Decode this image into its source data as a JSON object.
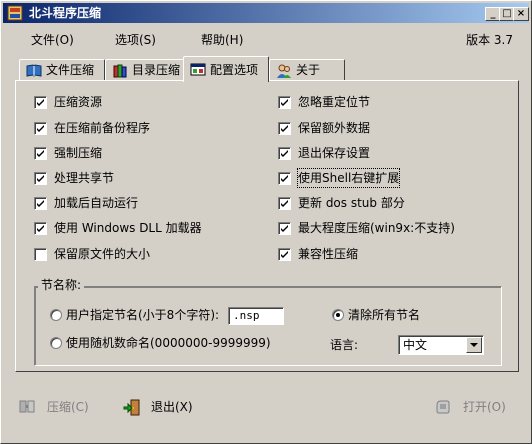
{
  "window": {
    "title": "北斗程序压缩",
    "minimize_label": "_",
    "maximize_label": "□",
    "close_label": "×"
  },
  "menu": [
    {
      "label": "文件(O)"
    },
    {
      "label": "选项(S)"
    },
    {
      "label": "帮助(H)"
    }
  ],
  "version": "版本 3.7",
  "tabs": [
    {
      "label": "文件压缩",
      "icon": "book-icon",
      "active": false
    },
    {
      "label": "目录压缩",
      "icon": "books-icon",
      "active": false
    },
    {
      "label": "配置选项",
      "icon": "config-icon",
      "active": true
    },
    {
      "label": "关于",
      "icon": "users-icon",
      "active": false
    }
  ],
  "options_left": [
    {
      "label": "压缩资源",
      "checked": true
    },
    {
      "label": "在压缩前备份程序",
      "checked": true
    },
    {
      "label": "强制压缩",
      "checked": true
    },
    {
      "label": "处理共享节",
      "checked": true
    },
    {
      "label": "加载后自动运行",
      "checked": true
    },
    {
      "label": "使用 Windows DLL 加载器",
      "checked": true
    },
    {
      "label": "保留原文件的大小",
      "checked": false
    }
  ],
  "options_right": [
    {
      "label": "忽略重定位节",
      "checked": true
    },
    {
      "label": "保留额外数据",
      "checked": true
    },
    {
      "label": "退出保存设置",
      "checked": true
    },
    {
      "label": "使用Shell右键扩展",
      "checked": true,
      "focused": true
    },
    {
      "label": "更新 dos stub 部分",
      "checked": true
    },
    {
      "label": "最大程度压缩(win9x:不支持)",
      "checked": true
    },
    {
      "label": "兼容性压缩",
      "checked": true
    }
  ],
  "section_names": {
    "title": "节名称:",
    "custom_label": "用户指定节名(小于8个字符):",
    "custom_value": ".nsp",
    "custom_selected": false,
    "random_label": "使用随机数命名(0000000-9999999)",
    "random_selected": false,
    "clear_label": "清除所有节名",
    "clear_selected": true,
    "language_label": "语言:",
    "language_value": "中文"
  },
  "buttons": {
    "compress": "压缩(C)",
    "exit": "退出(X)",
    "open": "打开(O)"
  }
}
